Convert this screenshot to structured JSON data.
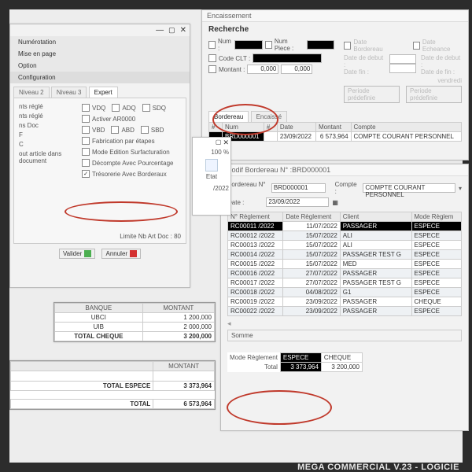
{
  "footer": "MEGA COMMERCIAL V.23 - LOGICIE",
  "encaissement": {
    "title": "Encaissement",
    "recherche": "Recherche",
    "num_lbl": "Num :",
    "num_piece_lbl": "Num Piece :",
    "code_clt_lbl": "Code CLT :",
    "montant_lbl": "Montant :",
    "montant_val": "0,000",
    "montant_val2": "0,000",
    "date_bord_lbl": "Date Bordereau",
    "date_ech_lbl": "Date Echeance",
    "date_debut_lbl": "Date de debut :",
    "date_fin_lbl": "Date fin :",
    "date_debut2_lbl": "Date de debut :",
    "date_fin2_lbl": "Date de fin :",
    "weekday": "vendredi",
    "per_pre": "Periode prédefinie",
    "tabs": {
      "bord": "Bordereau",
      "enc": "Encaissé"
    },
    "grid": {
      "cols": {
        "num": "Num",
        "date": "Date",
        "montant": "Montant",
        "compte": "Compte"
      },
      "row": {
        "num": "BRD000001",
        "date": "23/09/2022",
        "montant": "6 573,964",
        "compte": "COMPTE COURANT PERSONNEL"
      }
    },
    "sharp": "#"
  },
  "modif": {
    "title": "Modif  Bordereau N° :BRD000001",
    "bord_lbl": "Bordereau N° :",
    "bord_val": "BRD000001",
    "compte_lbl": "Compte :",
    "compte_val": "COMPTE COURANT PERSONNEL",
    "date_lbl": "Date :",
    "date_val": "23/09/2022",
    "grid": {
      "cols": {
        "nreg": "N° Règlement",
        "dreg": "Date Règlement",
        "client": "Client",
        "mode": "Mode Règlem"
      },
      "rows": [
        {
          "n": "RC00011 /2022",
          "d": "11/07/2022",
          "c": "PASSAGER",
          "m": "ESPECE"
        },
        {
          "n": "RC00012 /2022",
          "d": "15/07/2022",
          "c": "ALI",
          "m": "ESPECE"
        },
        {
          "n": "RC00013 /2022",
          "d": "15/07/2022",
          "c": "ALI",
          "m": "ESPECE"
        },
        {
          "n": "RC00014 /2022",
          "d": "15/07/2022",
          "c": "PASSAGER TEST G",
          "m": "ESPECE"
        },
        {
          "n": "RC00015 /2022",
          "d": "15/07/2022",
          "c": "MED",
          "m": "ESPECE"
        },
        {
          "n": "RC00016 /2022",
          "d": "27/07/2022",
          "c": "PASSAGER",
          "m": "ESPECE"
        },
        {
          "n": "RC00017 /2022",
          "d": "27/07/2022",
          "c": "PASSAGER TEST G",
          "m": "ESPECE"
        },
        {
          "n": "RC00018 /2022",
          "d": "04/08/2022",
          "c": "G1",
          "m": "ESPECE"
        },
        {
          "n": "RC00019 /2022",
          "d": "23/09/2022",
          "c": "PASSAGER",
          "m": "CHEQUE"
        },
        {
          "n": "RC00022 /2022",
          "d": "23/09/2022",
          "c": "PASSAGER",
          "m": "ESPECE"
        }
      ]
    },
    "somme_lbl": "Somme",
    "totals": {
      "mode_lbl": "Mode Règlement",
      "espece_lbl": "ESPECE",
      "cheque_lbl": "CHEQUE",
      "total_lbl": "Total",
      "espece_val": "3 373,964",
      "cheque_val": "3 200,000"
    }
  },
  "settings": {
    "menu": {
      "num": "Numérotation",
      "mp": "Mise en page",
      "opt": "Option",
      "conf": "Configuration"
    },
    "tabs": {
      "n2": "Niveau 2",
      "n3": "Niveau 3",
      "ex": "Expert"
    },
    "left_items": [
      "nts réglé",
      "nts réglé",
      "ns Doc",
      "F",
      "C",
      "out article dans document",
      "",
      "",
      "",
      ""
    ],
    "right_items": [
      {
        "code": "VDQ",
        "checked": false
      },
      {
        "code": "ADQ",
        "checked": false
      },
      {
        "code": "SDQ",
        "checked": false
      },
      {
        "code": "Activer AR0000",
        "checked": false
      },
      {
        "code": "VBD",
        "checked": false
      },
      {
        "code": "ABD",
        "checked": false
      },
      {
        "code": "SBD",
        "checked": false
      },
      {
        "code": "Fabrication par étapes",
        "checked": false
      },
      {
        "code": "Mode Edition Surfacturation",
        "checked": false
      },
      {
        "code": "Décompte Avec Pourcentage",
        "checked": false
      },
      {
        "code": "Trésorerie Avec Borderaux",
        "checked": true
      }
    ],
    "limite": "Limite Nb Art Doc : 80",
    "valider": "Valider",
    "annuler": "Annuler"
  },
  "midwin": {
    "pct": "100 %",
    "etat": "Etat",
    "date": "/2022"
  },
  "cheque_table": {
    "cols": {
      "banque": "BANQUE",
      "montant": "MONTANT"
    },
    "rows": [
      {
        "b": "UBCI",
        "m": "1 200,000"
      },
      {
        "b": "UIB",
        "m": "2 000,000"
      }
    ],
    "total_lbl": "TOTAL CHEQUE",
    "total_val": "3 200,000"
  },
  "espece_table": {
    "montant_lbl": "MONTANT",
    "total_esp_lbl": "TOTAL ESPECE",
    "total_esp_val": "3 373,964",
    "total_lbl": "TOTAL",
    "total_val": "6 573,964"
  }
}
